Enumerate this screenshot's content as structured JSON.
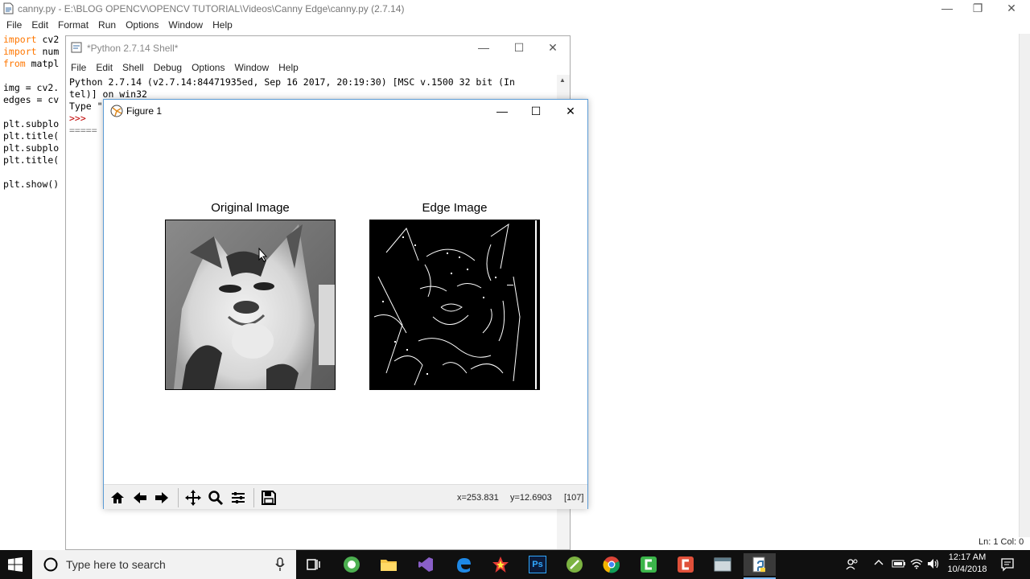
{
  "editor": {
    "title": "canny.py - E:\\BLOG OPENCV\\OPENCV TUTORIAL\\Videos\\Canny Edge\\canny.py (2.7.14)",
    "menu": [
      "File",
      "Edit",
      "Format",
      "Run",
      "Options",
      "Window",
      "Help"
    ],
    "code": {
      "l1_kw": "import",
      "l1_rest": " cv2",
      "l2_kw": "import",
      "l2_rest": " num",
      "l3_kw": "from",
      "l3_rest": " matpl",
      "l5": "img = cv2.",
      "l6": "edges = cv",
      "l8": "plt.subplo",
      "l9": "plt.title(",
      "l10": "plt.subplo",
      "l11": "plt.title(",
      "l13": "plt.show()"
    },
    "status": "Ln: 1   Col: 0"
  },
  "shell": {
    "title": "*Python 2.7.14 Shell*",
    "menu": [
      "File",
      "Edit",
      "Shell",
      "Debug",
      "Options",
      "Window",
      "Help"
    ],
    "line1": "Python 2.7.14 (v2.7.14:84471935ed, Sep 16 2017, 20:19:30) [MSC v.1500 32 bit (In",
    "line2": "tel)] on win32",
    "line3": "Type \"",
    "prompt": ">>>",
    "line5": "====="
  },
  "figure": {
    "title": "Figure 1",
    "subplots": [
      {
        "title": "Original Image"
      },
      {
        "title": "Edge Image"
      }
    ],
    "toolbar": {
      "icons": [
        "home-icon",
        "back-icon",
        "forward-icon",
        "pan-icon",
        "zoom-icon",
        "configure-icon",
        "save-icon"
      ],
      "x_readout": "x=253.831",
      "y_readout": "y=12.6903",
      "value_readout": "[107]"
    }
  },
  "taskbar": {
    "search_placeholder": "Type here to search",
    "time": "12:17 AM",
    "date": "10/4/2018",
    "apps": [
      "task-view-icon",
      "app-green-icon",
      "file-explorer-icon",
      "visual-studio-icon",
      "edge-browser-icon",
      "star-app-icon",
      "photoshop-icon",
      "green-app-icon",
      "chrome-icon",
      "camtasia-icon",
      "red-app-icon",
      "window-app-icon",
      "python-idle-icon"
    ],
    "photoshop_label": "Ps"
  },
  "colors": {
    "keyword": "#ff7700",
    "prompt": "#c00000",
    "taskbar": "#101010",
    "figure_border": "#5b9bd5"
  }
}
